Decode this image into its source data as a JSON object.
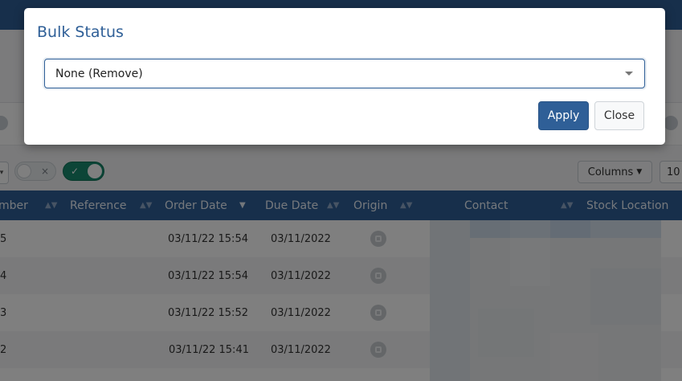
{
  "modal": {
    "title": "Bulk Status",
    "select_value": "None (Remove)",
    "apply_label": "Apply",
    "close_label": "Close"
  },
  "toolbar": {
    "toggle_off_glyph": "×",
    "toggle_on_glyph": "✓",
    "columns_label": "Columns",
    "page_size": "10"
  },
  "table": {
    "headers": [
      "mber",
      "Reference",
      "Order Date",
      "Due Date",
      "Origin",
      "Contact",
      "Stock Location"
    ],
    "rows": [
      {
        "number": "5",
        "reference": "",
        "order_date": "03/11/22 15:54",
        "due_date": "03/11/2022"
      },
      {
        "number": "4",
        "reference": "",
        "order_date": "03/11/22 15:54",
        "due_date": "03/11/2022"
      },
      {
        "number": "3",
        "reference": "",
        "order_date": "03/11/22 15:52",
        "due_date": "03/11/2022"
      },
      {
        "number": "2",
        "reference": "",
        "order_date": "03/11/22 15:41",
        "due_date": "03/11/2022"
      }
    ]
  },
  "icons": {
    "origin": "origin-icon",
    "sort": "sort-icon",
    "sort_active": "sort-desc-icon",
    "select_caret": "chevron-down-icon"
  },
  "colors": {
    "brand": "#2f5f97",
    "toggle_on": "#188a6f"
  }
}
